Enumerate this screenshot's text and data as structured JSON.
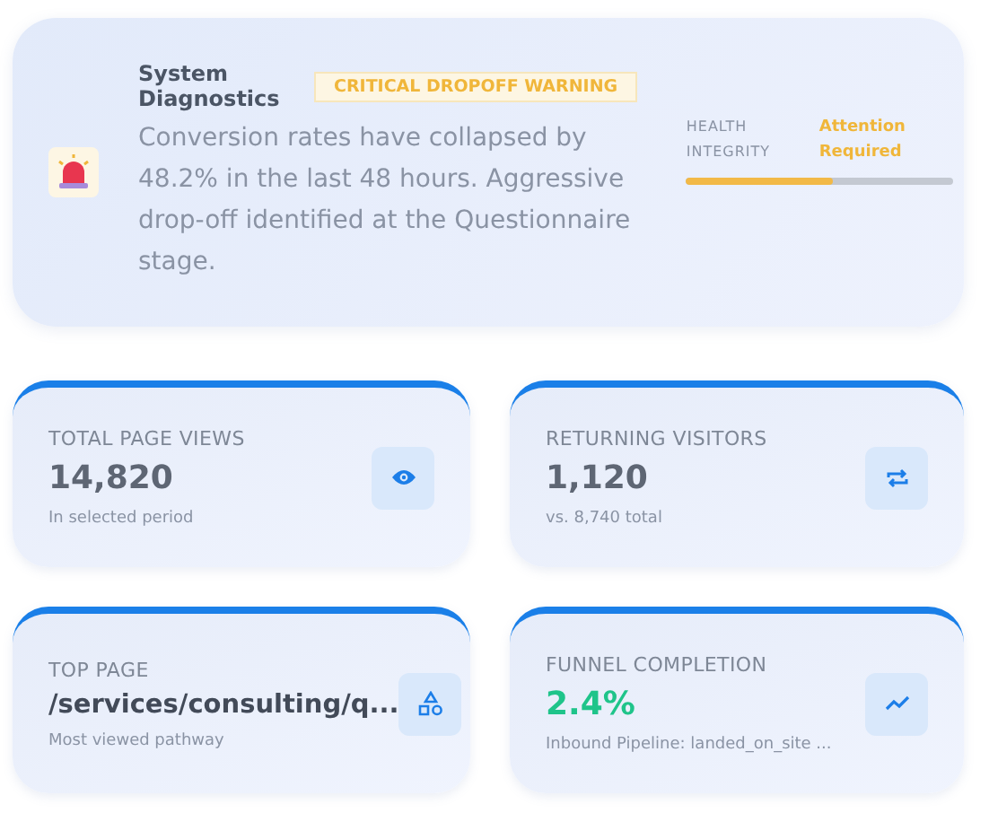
{
  "alert": {
    "title": "System Diagnostics",
    "badge": "CRITICAL DROPOFF WARNING",
    "message": "Conversion rates have collapsed by 48.2% in the last 48 hours. Aggressive drop-off identified at the Questionnaire stage.",
    "health_label": "HEALTH INTEGRITY",
    "health_status": "Attention Required",
    "level": 0.55
  },
  "stats": [
    {
      "kind": "views",
      "label": "TOTAL PAGE VIEWS",
      "value": "14,820",
      "note": "In selected period"
    },
    {
      "kind": "returning",
      "label": "RETURNING VISITORS",
      "value": "1,120",
      "note": "vs. 8,740 total"
    },
    {
      "kind": "page",
      "label": "TOP PAGE",
      "value": "/services/consulting/q...",
      "note": "Most viewed pathway"
    },
    {
      "kind": "funnel",
      "label": "FUNNEL COMPLETION",
      "value": "2.4%",
      "note": "Inbound Pipeline: landed_on_site ..."
    }
  ]
}
